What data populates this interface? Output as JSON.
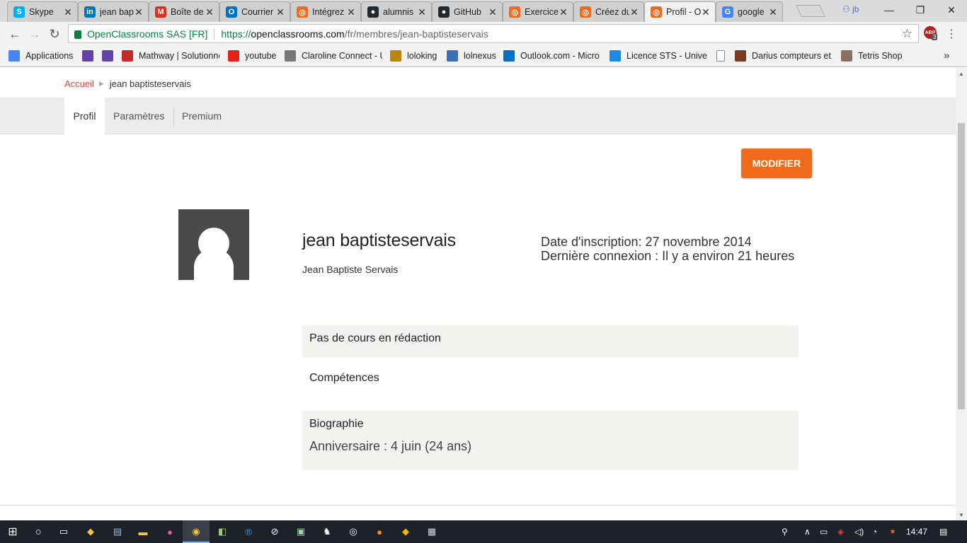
{
  "browser": {
    "tabs": [
      {
        "title": "Skype",
        "icon": "skype-icon",
        "color": "#00aff0",
        "glyph": "S"
      },
      {
        "title": "jean baptiste",
        "icon": "linkedin-icon",
        "color": "#0077b5",
        "glyph": "in"
      },
      {
        "title": "Boîte de réception",
        "icon": "gmail-icon",
        "color": "#d93025",
        "glyph": "M"
      },
      {
        "title": "Courrier",
        "icon": "outlook-icon",
        "color": "#0072c6",
        "glyph": "O"
      },
      {
        "title": "Intégrez",
        "icon": "openclassrooms-icon",
        "color": "#f06a1b",
        "glyph": "◎"
      },
      {
        "title": "alumnis",
        "icon": "github-icon",
        "color": "#24292e",
        "glyph": "●"
      },
      {
        "title": "GitHub",
        "icon": "github-icon",
        "color": "#24292e",
        "glyph": "●"
      },
      {
        "title": "Exercice",
        "icon": "openclassrooms-icon",
        "color": "#f06a1b",
        "glyph": "◎"
      },
      {
        "title": "Créez du",
        "icon": "openclassrooms-icon",
        "color": "#f06a1b",
        "glyph": "◎"
      },
      {
        "title": "Profil - OpenClassrooms",
        "icon": "openclassrooms-icon",
        "color": "#f06a1b",
        "glyph": "◎",
        "active": true
      },
      {
        "title": "google",
        "icon": "google-icon",
        "color": "#4285f4",
        "glyph": "G"
      }
    ],
    "profile_chip": "jb",
    "url": {
      "site_identity": "OpenClassrooms SAS [FR]",
      "scheme": "https://",
      "host": "openclassrooms.com",
      "path": "/fr/membres/jean-baptisteservais"
    },
    "extension_badge": "3",
    "extension_label": "ABP"
  },
  "bookmarks": [
    {
      "label": "Applications",
      "icon": "apps-grid-icon",
      "color": "#4285f4"
    },
    {
      "label": "",
      "icon": "twitch-icon",
      "color": "#6441a5"
    },
    {
      "label": "",
      "icon": "twitch-icon",
      "color": "#6441a5"
    },
    {
      "label": "Mathway | Solutionne",
      "icon": "mathway-icon",
      "color": "#c62828"
    },
    {
      "label": "youtube",
      "icon": "youtube-icon",
      "color": "#e62117"
    },
    {
      "label": "Claroline Connect - U",
      "icon": "claroline-icon",
      "color": "#777777"
    },
    {
      "label": "loloking",
      "icon": "crown-icon",
      "color": "#b8860b"
    },
    {
      "label": "lolnexus",
      "icon": "lolnexus-icon",
      "color": "#3f6fb5"
    },
    {
      "label": "Outlook.com - Micro",
      "icon": "outlook-icon",
      "color": "#0072c6"
    },
    {
      "label": "Licence STS - Univers",
      "icon": "folder-flag-icon",
      "color": "#1e88e5"
    },
    {
      "label": "",
      "icon": "page-icon",
      "color": "#ffffff"
    },
    {
      "label": "Darius compteurs et",
      "icon": "darius-icon",
      "color": "#7a3b1e"
    },
    {
      "label": "Tetris Shop",
      "icon": "tetris-icon",
      "color": "#8d6e63"
    }
  ],
  "breadcrumb": {
    "home": "Accueil",
    "current": "jean baptisteservais"
  },
  "profile_tabs": [
    "Profil",
    "Paramètres",
    "Premium"
  ],
  "actions": {
    "modify": "MODIFIER"
  },
  "profile": {
    "username": "jean baptisteservais",
    "full_name": "Jean Baptiste Servais",
    "signup": "Date d'inscription: 27 novembre 2014",
    "last_login": "Dernière connexion : Il y a environ 21 heures"
  },
  "sections": {
    "courses": "Pas de cours en rédaction",
    "skills": "Compétences",
    "bio_title": "Biographie",
    "birthday": "Anniversaire : 4 juin (24 ans)"
  },
  "taskbar": {
    "time": "14:47"
  },
  "colors": {
    "accent": "#f06a1b",
    "breadcrumb_link": "#d0473f",
    "secure_green": "#0b8043"
  }
}
